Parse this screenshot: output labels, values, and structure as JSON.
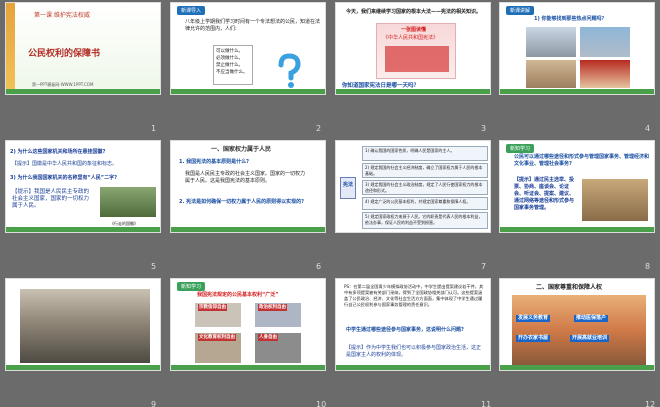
{
  "slides": [
    {
      "num": "1",
      "course": "第一课  维护宪法权威",
      "title": "公民权利的保障书",
      "footer": "第一PPT模板网-WWW.1PPT.COM"
    },
    {
      "num": "2",
      "tab": "新课导入",
      "text": "八年级上学期我们学习时间有一个专法想法的公民，知道在法律允许的范围内，人们:",
      "checklist": [
        "可以做什么。",
        "必须做什么。",
        "禁止做什么。",
        "不应当做什么。"
      ]
    },
    {
      "num": "3",
      "text1": "今天，我们来继续学习国家的根本大法——宪法的相关知识。",
      "card_title": "一张图读懂",
      "card_sub": "《中华人民共和国宪法》",
      "question": "你知道国家宪法日是哪一天吗？"
    },
    {
      "num": "4",
      "tab": "新课讲解",
      "q1": "1) 你能够找到那些热点问题吗？"
    },
    {
      "num": "5",
      "q2": "2) 为什么这些国家机关和场所在悬挂国徽?",
      "a2": "【提示】国徽是中华人民共和国的象征和标志。",
      "q3": "3) 为什么我国国家机关的名称里有“人民”二字?",
      "a3": "【提示】我国是人民民主专政的社会主义国家，国家的一切权力属于人民。",
      "caption": "《行走的国徽》"
    },
    {
      "num": "6",
      "heading": "一、国家权力属于人民",
      "q1": "1. 我国宪法的基本原则是什么?",
      "a1": "我国是人民民主专政的社会主义国家。国家的一切权力属于人民。这是我国宪法的基本原则。",
      "q2": "2. 宪法是如何确保一切权力属于人民的原则得以实现的?"
    },
    {
      "num": "7",
      "side_label": "宪法",
      "items": [
        "1) 确认我国的国家性质，明确人民是国家的主人。",
        "2) 规定我国的社会主义经济制度，确立了国家权力属于人民的根本基础。",
        "3) 规定我国的社会主义政治制度，规定了人民行使国家权力的根本途径和形式。",
        "4) 规定广泛的公民基本权利，并规定国家尊重和保障人权。",
        "5) 规定国家政权力来源于人民。它的职责是代表人民的根本利益，依法办事，保证人民的利益不受到损害。"
      ]
    },
    {
      "num": "8",
      "tab": "新知学习",
      "q": "公民可以通过哪些途径和形式参与管理国家事务、管理经济和文化事业、管理社会事务?",
      "a": "【提示】通过民主选举、投票、协商、座谈会、论证会、听证会、提案、建议、通过网络等途径和形式参与国家事务管理。"
    },
    {
      "num": "9"
    },
    {
      "num": "10",
      "tab": "新知学习",
      "title": "我国宪法规定的公民基本权利“广泛”",
      "tags": [
        "宗教信仰自由",
        "政治权利自由",
        "文化教育权利自由",
        "人身自由"
      ]
    },
    {
      "num": "11",
      "ps": "PS：在第二届全国青少年模拟政协活动中，中学生提出提案建议若干件，其中有多项提案被有关部门采纳，得到了全国政协相关部门认可。这些提案涵盖了公民政治、经济、文化等社会生活方方面面，集中体现了中学生通过履行自己公民权利参与国家事务管理的责任意识。",
      "q": "中学生通过哪些途径参与国家事务，这说明什么问题?",
      "a": "【提示】作为中学生我们也可以积极参与国家政治生活，这正是国家主人的权利的体现。"
    },
    {
      "num": "12",
      "heading": "二、国家尊重和保障人权",
      "tags": [
        "发展义务教育",
        "推动医保落户",
        "开办农家书屋",
        "开展高就业培训"
      ]
    }
  ]
}
